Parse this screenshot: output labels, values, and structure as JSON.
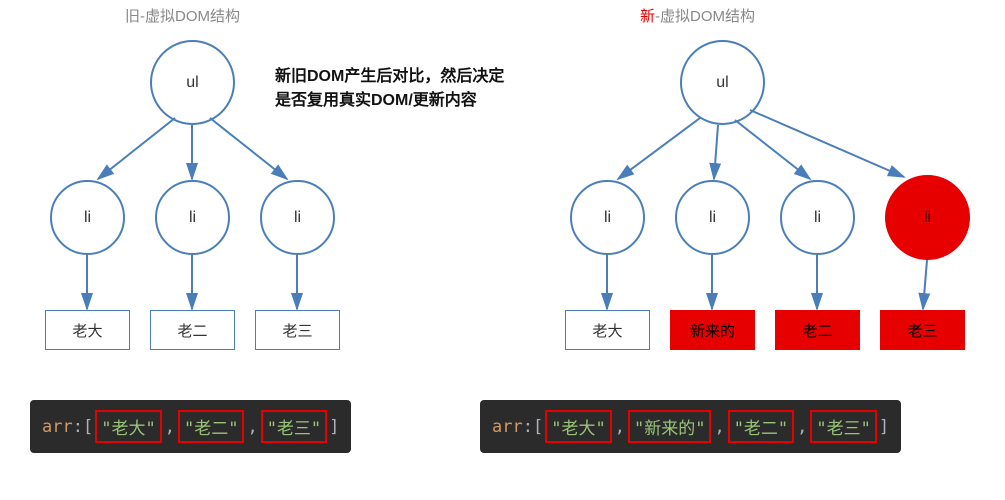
{
  "titles": {
    "old_prefix": "旧",
    "old_suffix": "-虚拟DOM结构",
    "new_prefix": "新",
    "new_suffix": "-虚拟DOM结构"
  },
  "center_note": {
    "line1": "新旧DOM产生后对比，然后决定",
    "line2": "是否复用真实DOM/更新内容"
  },
  "nodes": {
    "ul": "ul",
    "li": "li"
  },
  "old_labels": [
    "老大",
    "老二",
    "老三"
  ],
  "new_labels": [
    "老大",
    "新来的",
    "老二",
    "老三"
  ],
  "code": {
    "key": "arr",
    "colon": ": ",
    "open": "[",
    "close": "]",
    "sep": ",",
    "old_values": [
      "\"老大\"",
      "\"老二\"",
      "\"老三\""
    ],
    "new_values": [
      "\"老大\"",
      "\"新来的\"",
      "\"老二\"",
      "\"老三\""
    ]
  }
}
